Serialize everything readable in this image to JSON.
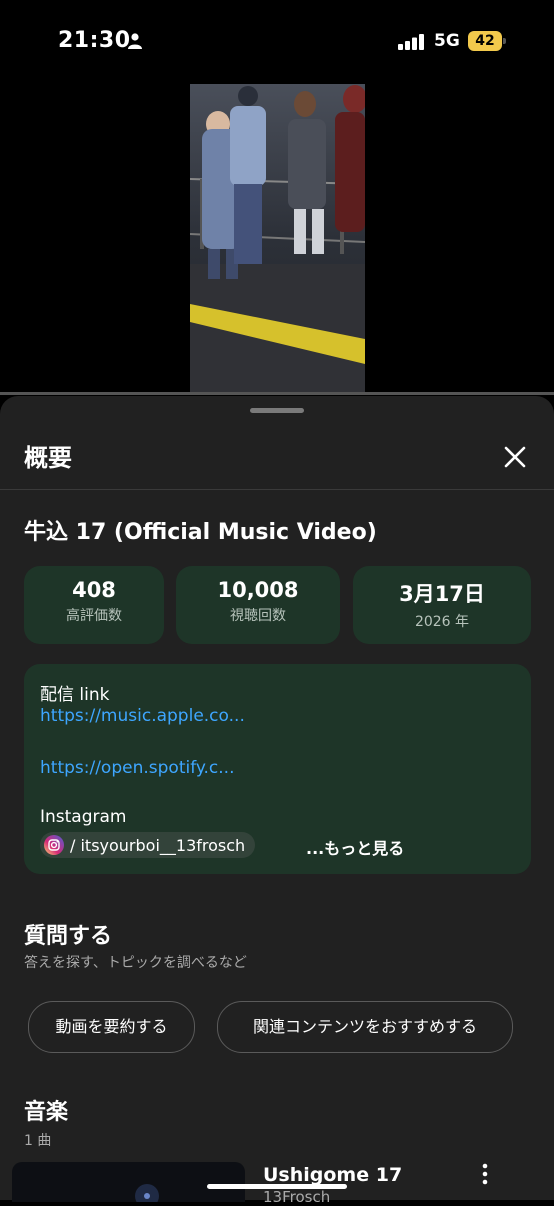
{
  "status_bar": {
    "time": "21:30",
    "network": "5G",
    "battery": "42"
  },
  "sheet": {
    "title": "概要",
    "video_title": "牛込 17 (Official Music Video)",
    "stats": [
      {
        "value": "408",
        "label": "高評価数"
      },
      {
        "value": "10,008",
        "label": "視聴回数"
      },
      {
        "value": "3月17日",
        "label": "2026 年"
      }
    ],
    "description": {
      "heading": "配信 link",
      "link1": "https://music.apple.co...",
      "link2": "https://open.spotify.c...",
      "instagram_label": "Instagram",
      "instagram_handle": "/ itsyourboi__13frosch",
      "more": "...もっと見る"
    },
    "ask": {
      "title": "質問する",
      "subtitle": "答えを探す、トピックを調べるなど",
      "chips": [
        "動画を要約する",
        "関連コンテンツをおすすめする"
      ]
    },
    "music": {
      "title": "音楽",
      "count": "1 曲",
      "song_title": "Ushigome 17",
      "song_artist": "13Frosch"
    }
  },
  "colors": {
    "accent_link": "#3ea6ff",
    "card_bg": "#1e3528",
    "sheet_bg": "#212121",
    "battery": "#f2c94c"
  },
  "icons": [
    "person-icon",
    "signal-icon",
    "battery-icon",
    "close-icon",
    "instagram-icon",
    "kebab-icon"
  ]
}
